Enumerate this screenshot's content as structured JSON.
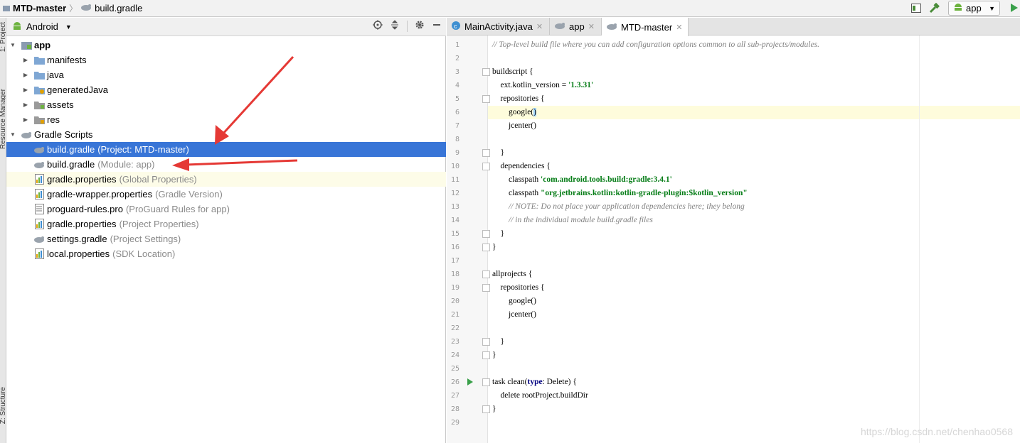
{
  "breadcrumb": {
    "project": "MTD-master",
    "file": "build.gradle"
  },
  "toolbar": {
    "run_config": "app"
  },
  "side_strip": {
    "top_label": "1: Project",
    "middle_label": "Resource Manager",
    "bottom_label": "Z: Structure"
  },
  "project_panel": {
    "view_mode": "Android"
  },
  "tree": [
    {
      "label": "app",
      "hint": "",
      "icon": "module-folder-icon",
      "expanded": true,
      "bold": true
    },
    {
      "label": "manifests",
      "hint": "",
      "icon": "folder-icon"
    },
    {
      "label": "java",
      "hint": "",
      "icon": "folder-icon"
    },
    {
      "label": "generatedJava",
      "hint": "",
      "icon": "generated-folder-icon"
    },
    {
      "label": "assets",
      "hint": "",
      "icon": "assets-folder-icon"
    },
    {
      "label": "res",
      "hint": "",
      "icon": "res-folder-icon"
    },
    {
      "label": "Gradle Scripts",
      "hint": "",
      "icon": "gradle-icon",
      "expanded": true
    },
    {
      "label": "build.gradle",
      "hint": "(Project: MTD-master)",
      "icon": "gradle-icon",
      "selected": true
    },
    {
      "label": "build.gradle",
      "hint": "(Module: app)",
      "icon": "gradle-icon"
    },
    {
      "label": "gradle.properties",
      "hint": "(Global Properties)",
      "icon": "properties-icon"
    },
    {
      "label": "gradle-wrapper.properties",
      "hint": "(Gradle Version)",
      "icon": "properties-icon"
    },
    {
      "label": "proguard-rules.pro",
      "hint": "(ProGuard Rules for app)",
      "icon": "text-file-icon"
    },
    {
      "label": "gradle.properties",
      "hint": "(Project Properties)",
      "icon": "properties-icon"
    },
    {
      "label": "settings.gradle",
      "hint": "(Project Settings)",
      "icon": "gradle-icon"
    },
    {
      "label": "local.properties",
      "hint": "(SDK Location)",
      "icon": "properties-icon"
    }
  ],
  "tabs": [
    {
      "label": "MainActivity.java",
      "icon": "java-class-icon"
    },
    {
      "label": "app",
      "icon": "gradle-icon"
    },
    {
      "label": "MTD-master",
      "icon": "gradle-icon",
      "active": true
    }
  ],
  "code_lines": [
    "// Top-level build file where you can add configuration options common to all sub-projects/modules.",
    "",
    "buildscript {",
    "    ext.kotlin_version = '1.3.31'",
    "    repositories {",
    "        google()",
    "        jcenter()",
    "",
    "    }",
    "    dependencies {",
    "        classpath 'com.android.tools.build:gradle:3.4.1'",
    "        classpath \"org.jetbrains.kotlin:kotlin-gradle-plugin:$kotlin_version\"",
    "        // NOTE: Do not place your application dependencies here; they belong",
    "        // in the individual module build.gradle files",
    "    }",
    "}",
    "",
    "allprojects {",
    "    repositories {",
    "        google()",
    "        jcenter()",
    "",
    "    }",
    "}",
    "",
    "task clean(type: Delete) {",
    "    delete rootProject.buildDir",
    "}",
    ""
  ],
  "line_numbers": [
    "1",
    "2",
    "3",
    "4",
    "5",
    "6",
    "7",
    "8",
    "9",
    "10",
    "11",
    "12",
    "13",
    "14",
    "15",
    "16",
    "17",
    "18",
    "19",
    "20",
    "21",
    "22",
    "23",
    "24",
    "25",
    "26",
    "27",
    "28",
    "29"
  ],
  "watermark": "https://blog.csdn.net/chenhao0568",
  "colors": {
    "selection": "#3875d7",
    "annotation_arrow": "#e53935",
    "string": "#067d17",
    "keyword": "#000080"
  }
}
